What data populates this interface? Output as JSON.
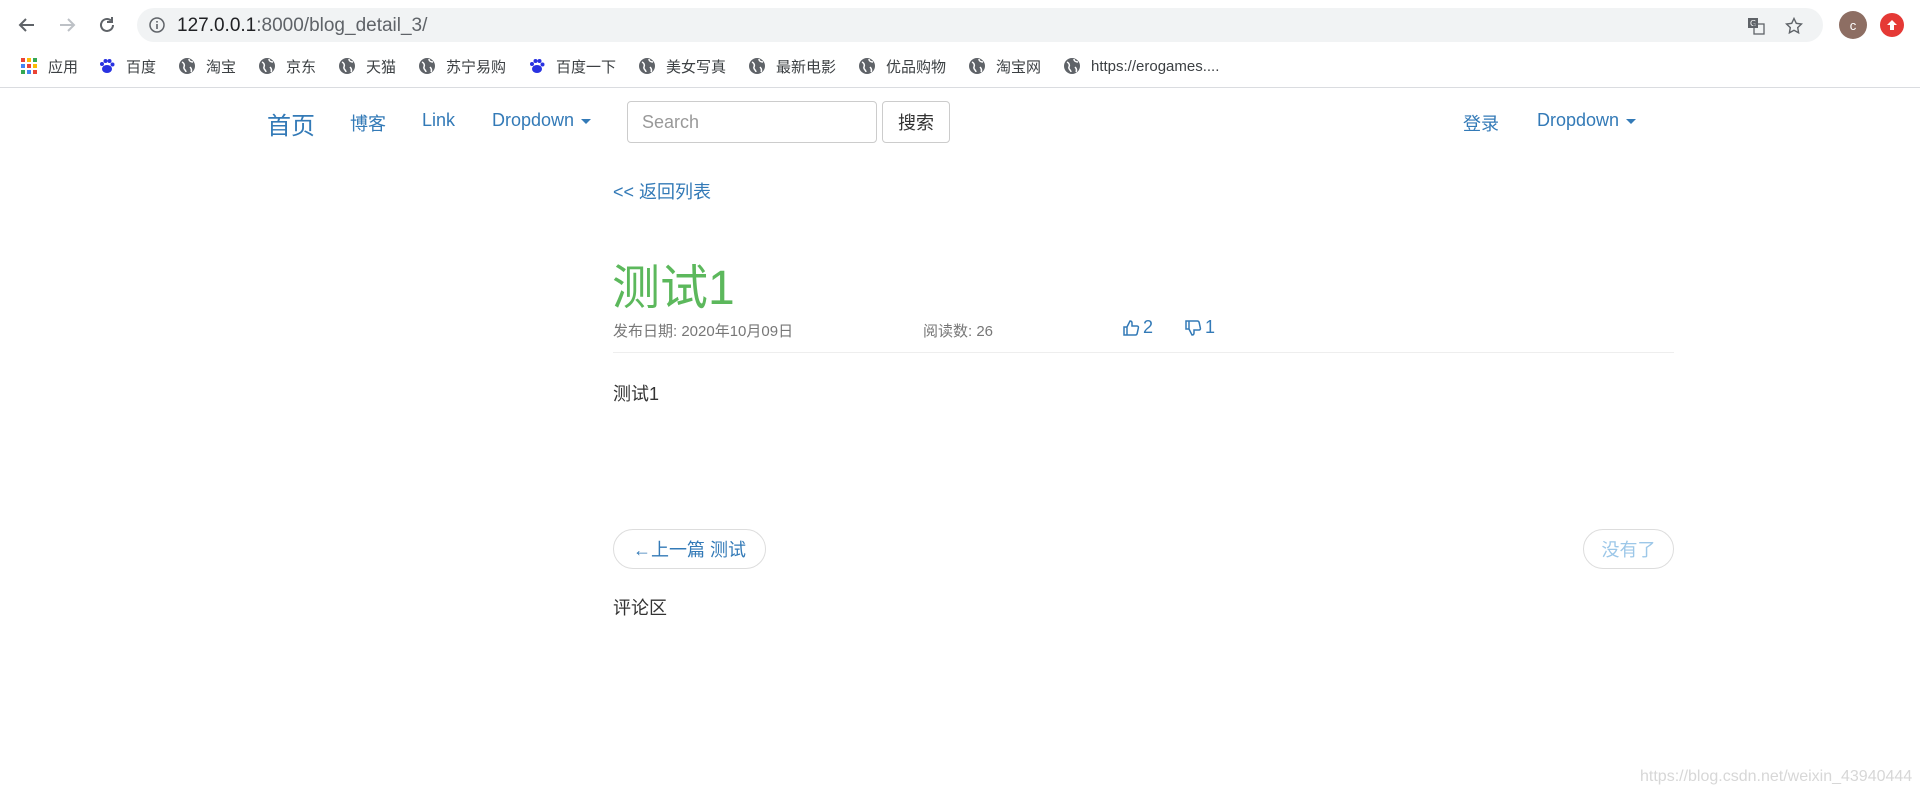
{
  "browser": {
    "url_host": "127.0.0.1",
    "url_path": ":8000/blog_detail_3/",
    "profile_initial": "c",
    "bookmarks": [
      {
        "label": "应用",
        "icon": "apps-grid-icon"
      },
      {
        "label": "百度",
        "icon": "baidu-paw-icon"
      },
      {
        "label": "淘宝",
        "icon": "globe-icon"
      },
      {
        "label": "京东",
        "icon": "globe-icon"
      },
      {
        "label": "天猫",
        "icon": "globe-icon"
      },
      {
        "label": "苏宁易购",
        "icon": "globe-icon"
      },
      {
        "label": "百度一下",
        "icon": "baidu-paw-icon"
      },
      {
        "label": "美女写真",
        "icon": "globe-icon"
      },
      {
        "label": "最新电影",
        "icon": "globe-icon"
      },
      {
        "label": "优品购物",
        "icon": "globe-icon"
      },
      {
        "label": "淘宝网",
        "icon": "globe-icon"
      },
      {
        "label": "https://erogames....",
        "icon": "globe-icon"
      }
    ]
  },
  "navbar": {
    "brand": "首页",
    "links": [
      "博客",
      "Link",
      "Dropdown"
    ],
    "search_placeholder": "Search",
    "search_button": "搜索",
    "right_links": [
      "登录",
      "Dropdown"
    ]
  },
  "article": {
    "back_link": "<< 返回列表",
    "title": "测试1",
    "publish_date": "发布日期: 2020年10月09日",
    "read_count": "阅读数: 26",
    "likes": "2",
    "dislikes": "1",
    "content": "测试1"
  },
  "pager": {
    "prev": "←上一篇 测试",
    "next": "没有了"
  },
  "comments_heading": "评论区",
  "watermark": "https://blog.csdn.net/weixin_43940444",
  "colors": {
    "link": "#337ab7",
    "title": "#5cb85c",
    "muted": "#777777"
  }
}
